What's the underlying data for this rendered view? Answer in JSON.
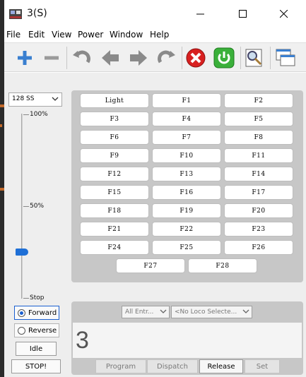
{
  "window": {
    "title": "3(S)"
  },
  "menu": [
    "File",
    "Edit",
    "View",
    "Power",
    "Window",
    "Help"
  ],
  "throttle": {
    "speed_steps": "128 SS",
    "labels": {
      "top": "100%",
      "mid": "50%",
      "bottom": "Stop"
    },
    "speed_fraction": 0.25,
    "forward": "Forward",
    "reverse": "Reverse",
    "direction": "Forward",
    "idle": "Idle",
    "stop": "STOP!"
  },
  "functions": [
    "Light",
    "F1",
    "F2",
    "F3",
    "F4",
    "F5",
    "F6",
    "F7",
    "F8",
    "F9",
    "F10",
    "F11",
    "F12",
    "F13",
    "F14",
    "F15",
    "F16",
    "F17",
    "F18",
    "F19",
    "F20",
    "F21",
    "F22",
    "F23",
    "F24",
    "F25",
    "F26",
    "F27",
    "F28"
  ],
  "address": {
    "roster_filter": "All Entr...",
    "loco_select": "<No Loco Selecte...",
    "value": "3",
    "buttons": {
      "program": "Program",
      "dispatch": "Dispatch",
      "release": "Release",
      "set": "Set"
    }
  },
  "colors": {
    "accent": "#1a5fd0",
    "stop_red": "#d82020",
    "power_green": "#3ab03a"
  }
}
